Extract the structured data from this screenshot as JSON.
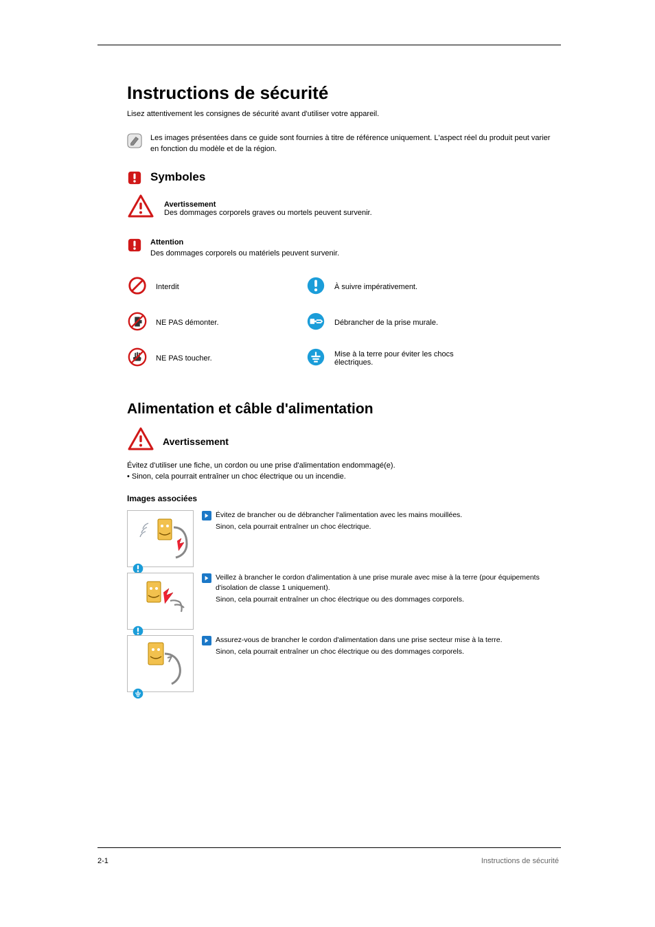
{
  "heading": "Instructions de sécurité",
  "intro": "Lisez attentivement les consignes de sécurité avant d'utiliser votre appareil.",
  "note": {
    "text": "Les images présentées dans ce guide sont fournies à titre de référence uniquement. L'aspect réel du produit peut varier en fonction du modèle et de la région."
  },
  "symbols": {
    "heading": "Symboles",
    "warn_label1": "Avertissement",
    "warn_text1": "Des dommages corporels graves ou mortels peuvent survenir.",
    "warn_label2": "Attention",
    "warn_text2": "Des dommages corporels ou matériels peuvent survenir."
  },
  "icons": [
    {
      "name": "prohibit-icon",
      "label": "Interdit"
    },
    {
      "name": "no-disassemble-icon",
      "label": "NE PAS démonter."
    },
    {
      "name": "no-touch-icon",
      "label": "NE PAS toucher."
    },
    {
      "name": "must-follow-icon",
      "label": "À suivre impérativement."
    },
    {
      "name": "unplug-icon",
      "label": "Débrancher de la prise murale."
    },
    {
      "name": "ground-icon",
      "label": "Mise à la terre pour éviter les chocs électriques."
    }
  ],
  "power_section": {
    "heading": "Alimentation et câble d'alimentation",
    "warn_label": "Avertissement",
    "warn_desc": "Évitez d'utiliser une fiche, un cordon ou une prise d'alimentation endommagé(e).\n• Sinon, cela pourrait entraîner un choc électrique ou un incendie.",
    "sub_heading": "Images associées"
  },
  "items": [
    {
      "lead": "Évitez de brancher ou de débrancher l'alimentation avec les mains mouillées.",
      "body": "Sinon, cela pourrait entraîner un choc électrique."
    },
    {
      "lead": "Veillez à brancher le cordon d'alimentation à une prise murale avec mise à la terre (pour équipements d'isolation de classe 1 uniquement).",
      "body": "Sinon, cela pourrait entraîner un choc électrique ou des dommages corporels."
    },
    {
      "lead": "Assurez-vous de brancher le cordon d'alimentation dans une prise secteur mise à la terre.",
      "body": "Sinon, cela pourrait entraîner un choc électrique ou des dommages corporels."
    }
  ],
  "page_number": "2-1",
  "footer": "Instructions de sécurité"
}
